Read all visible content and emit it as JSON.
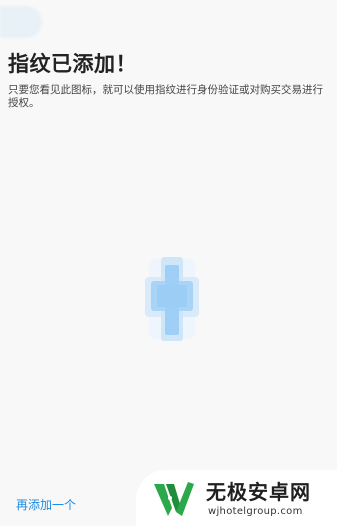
{
  "screen": {
    "title": "指纹已添加！",
    "description": "只要您看见此图标，就可以使用指纹进行身份验证或对购买交易进行授权。",
    "icon": "fingerprint-icon",
    "add_another_label": "再添加一个"
  },
  "watermark": {
    "name": "无极安卓网",
    "url": "wjhotelgroup.com",
    "logo": "wj-logo-icon"
  },
  "colors": {
    "background": "#f8f8f8",
    "accent": "#1e8be0",
    "icon_blue": "#9fcff6",
    "watermark_green": "#2aa84a"
  }
}
